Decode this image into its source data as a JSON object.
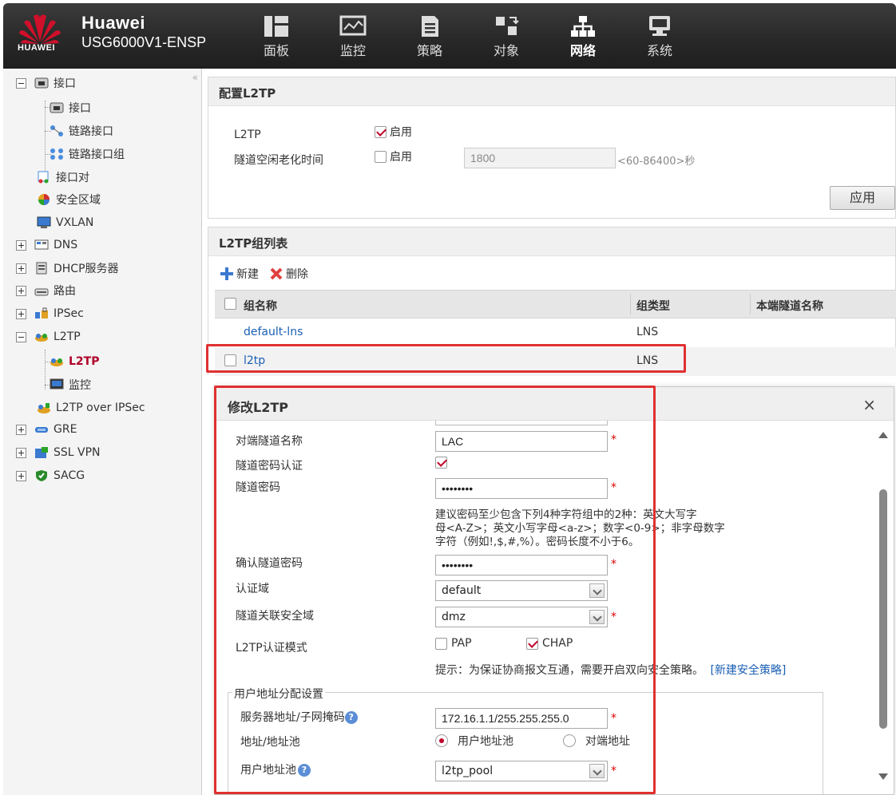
{
  "header": {
    "logo_text": "HUAWEI",
    "brand": "Huawei",
    "device": "USG6000V1-ENSP",
    "nav": [
      {
        "label": "面板",
        "icon": "dashboard-icon"
      },
      {
        "label": "监控",
        "icon": "monitor-icon"
      },
      {
        "label": "策略",
        "icon": "policy-icon"
      },
      {
        "label": "对象",
        "icon": "object-icon"
      },
      {
        "label": "网络",
        "icon": "network-icon"
      },
      {
        "label": "系统",
        "icon": "system-icon"
      }
    ],
    "active_nav": "网络"
  },
  "sidebar": {
    "collapse": "«",
    "items": [
      {
        "label": "接口"
      },
      {
        "label": "接口"
      },
      {
        "label": "链路接口"
      },
      {
        "label": "链路接口组"
      },
      {
        "label": "接口对"
      },
      {
        "label": "安全区域"
      },
      {
        "label": "VXLAN"
      },
      {
        "label": "DNS"
      },
      {
        "label": "DHCP服务器"
      },
      {
        "label": "路由"
      },
      {
        "label": "IPSec"
      },
      {
        "label": "L2TP"
      },
      {
        "label": "L2TP"
      },
      {
        "label": "监控"
      },
      {
        "label": "L2TP over IPSec"
      },
      {
        "label": "GRE"
      },
      {
        "label": "SSL VPN"
      },
      {
        "label": "SACG"
      }
    ]
  },
  "config_panel": {
    "title": "配置L2TP",
    "l2tp_label": "L2TP",
    "l2tp_enable": "启用",
    "idle_label": "隧道空闲老化时间",
    "idle_enable": "启用",
    "idle_value": "1800",
    "idle_range": "<60-86400>秒",
    "apply": "应用"
  },
  "group_panel": {
    "title": "L2TP组列表",
    "new": "新建",
    "delete": "删除",
    "columns": [
      "组名称",
      "组类型",
      "本端隧道名称"
    ],
    "rows": [
      {
        "name": "default-lns",
        "type": "LNS"
      },
      {
        "name": "l2tp",
        "type": "LNS"
      }
    ]
  },
  "dialog": {
    "title": "修改L2TP",
    "close": "×",
    "peer_tunnel_label": "对端隧道名称",
    "peer_tunnel_value": "LAC",
    "pwd_auth_label": "隧道密码认证",
    "pwd_label": "隧道密码",
    "pwd_value": "••••••••",
    "pwd_hint_1": "建议密码至少包含下列4种字符组中的2种：英文大写字",
    "pwd_hint_2": "母<A-Z>；英文小写字母<a-z>；数字<0-9>；非字母数字",
    "pwd_hint_3": "字符（例如!,$,#,%）。密码长度不小于6。",
    "confirm_label": "确认隧道密码",
    "confirm_value": "••••••••",
    "domain_label": "认证域",
    "domain_value": "default",
    "zone_label": "隧道关联安全域",
    "zone_value": "dmz",
    "auth_mode_label": "L2TP认证模式",
    "pap": "PAP",
    "chap": "CHAP",
    "tip": "提示：为保证协商报文互通，需要开启双向安全策略。",
    "tip_link": "[新建安全策略]",
    "fieldset_legend": "用户地址分配设置",
    "server_addr_label": "服务器地址/子网掩码",
    "server_addr_value": "172.16.1.1/255.255.255.0",
    "addr_mode_label": "地址/地址池",
    "addr_pool_opt": "用户地址池",
    "peer_addr_opt": "对端地址",
    "pool_label": "用户地址池",
    "pool_value": "l2tp_pool",
    "required_mark": "*",
    "help_mark": "?"
  },
  "colors": {
    "accent_red": "#e03030",
    "link_blue": "#1a5fb4",
    "brand_red": "#c0002a"
  }
}
